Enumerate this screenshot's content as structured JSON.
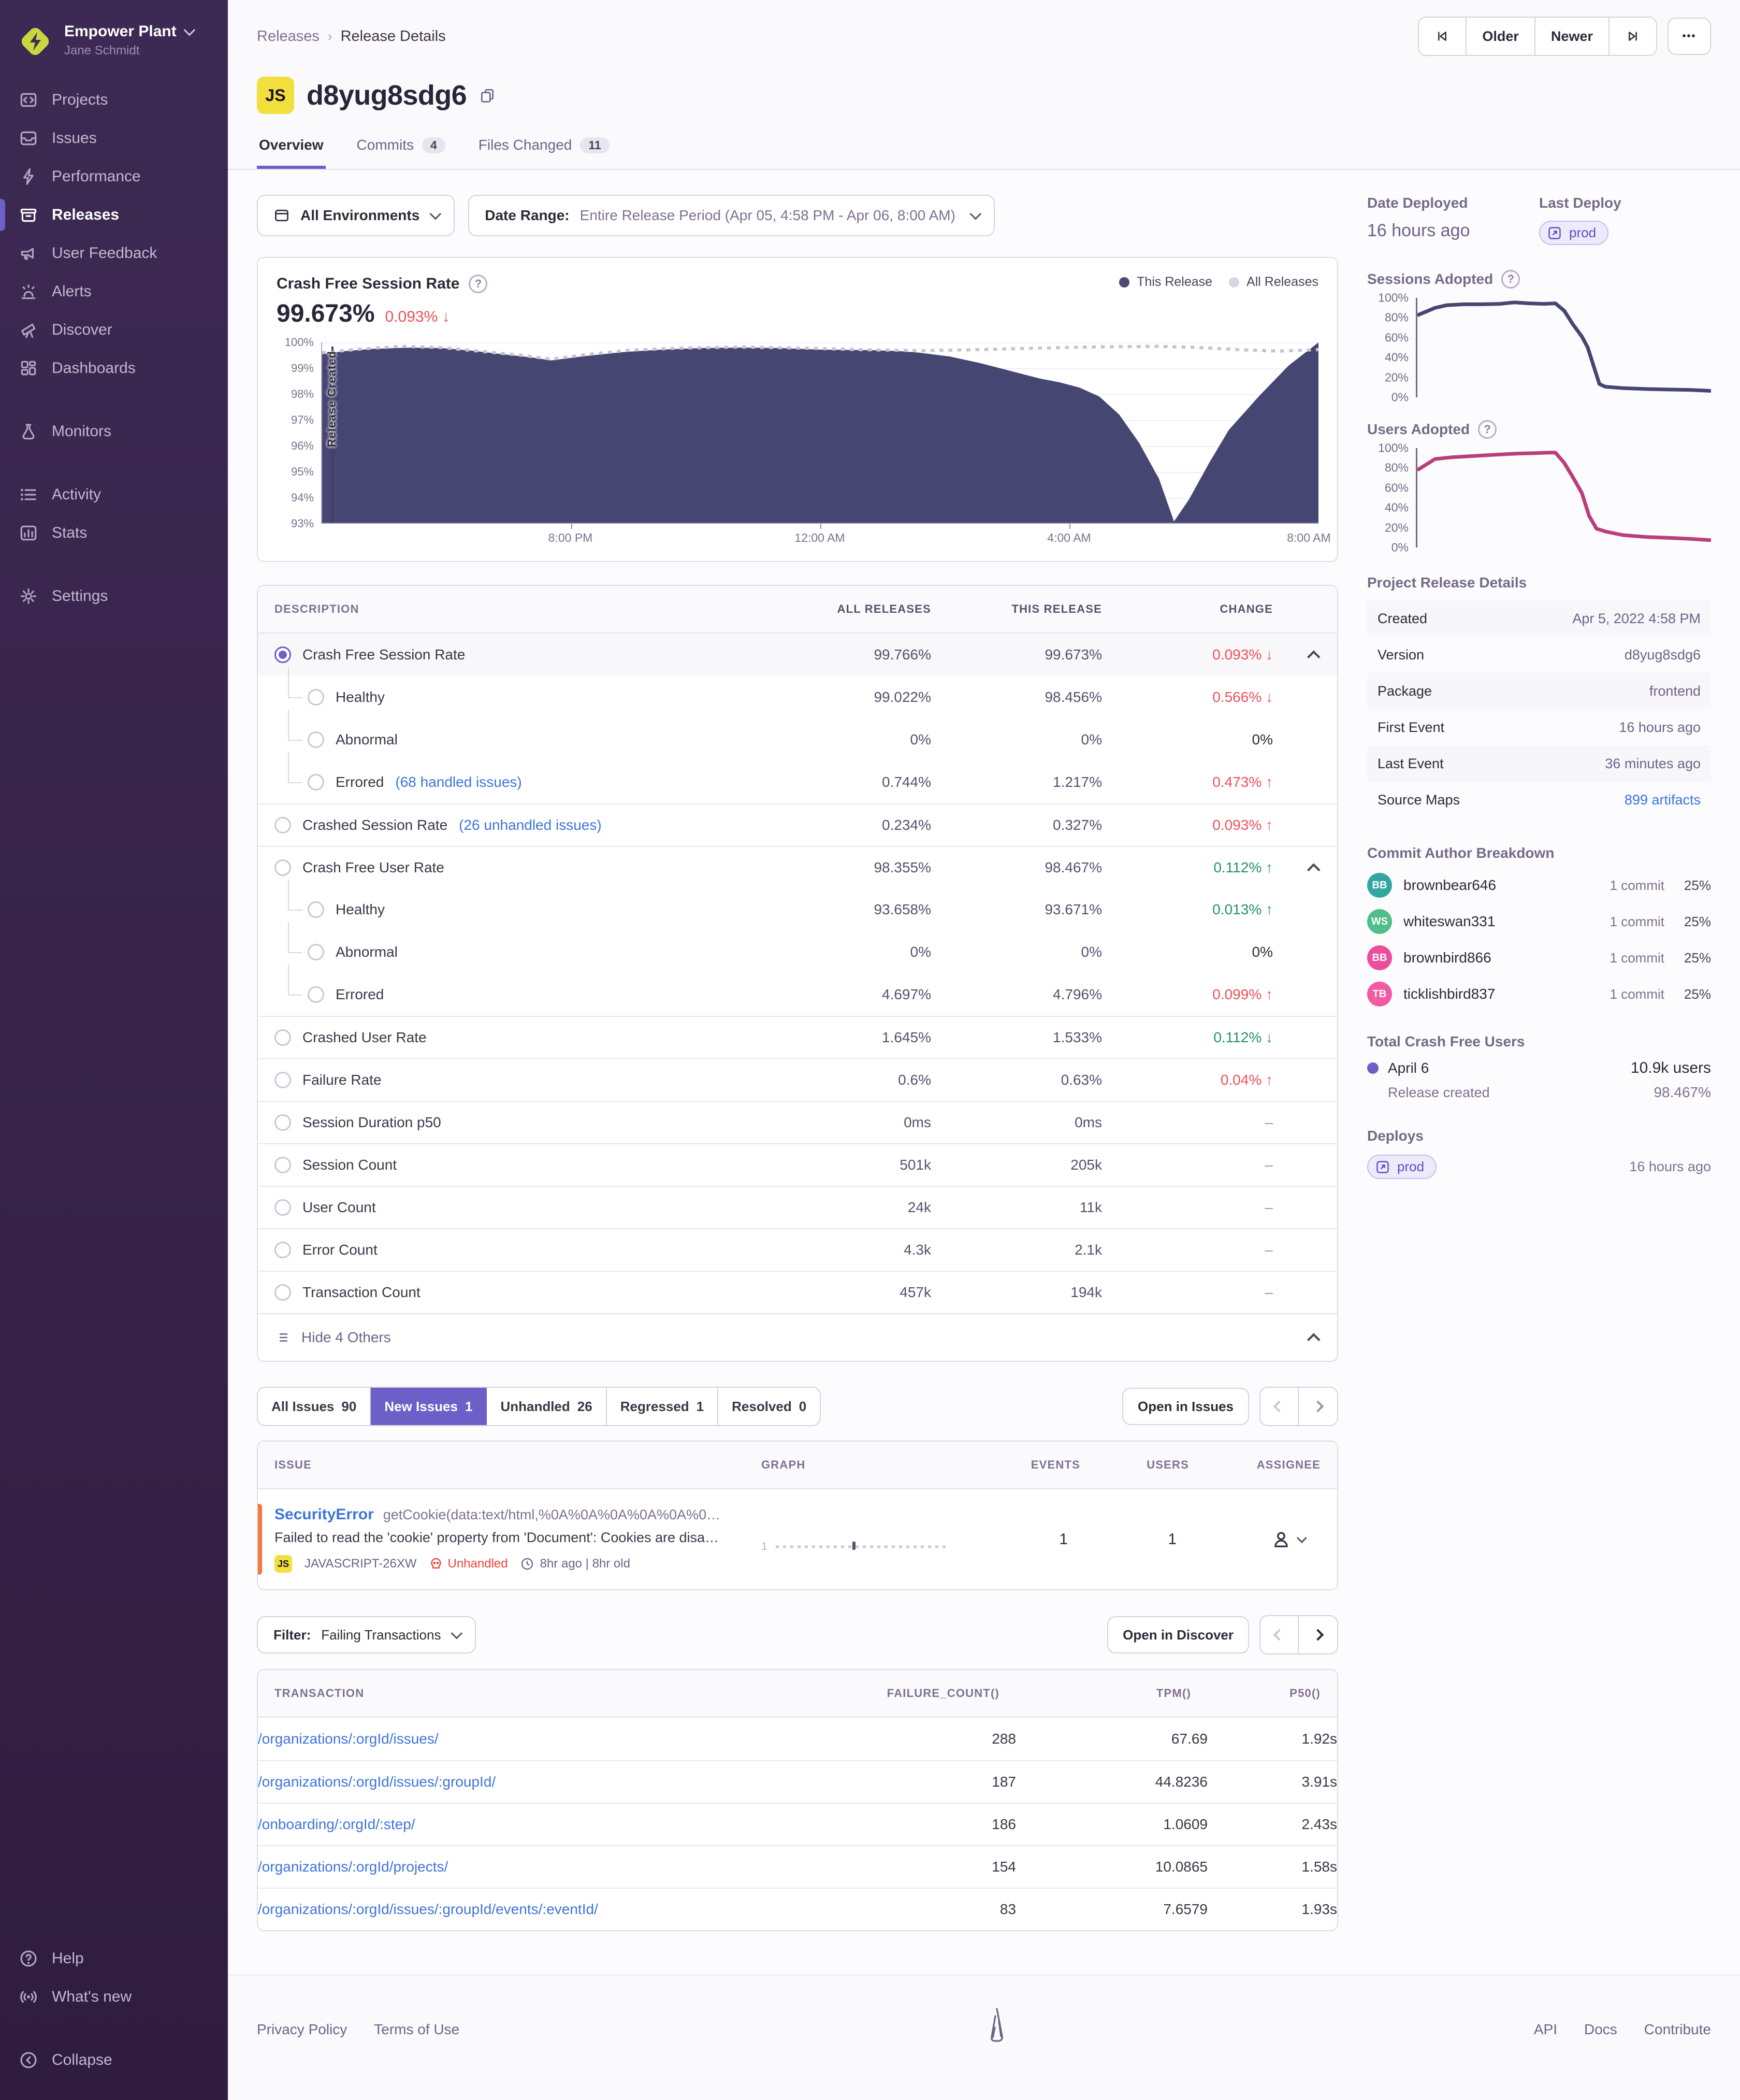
{
  "sidebar": {
    "org": "Empower Plant",
    "user": "Jane Schmidt",
    "items": [
      {
        "label": "Projects",
        "icon": "projects-icon"
      },
      {
        "label": "Issues",
        "icon": "issues-icon"
      },
      {
        "label": "Performance",
        "icon": "performance-icon"
      },
      {
        "label": "Releases",
        "icon": "releases-icon",
        "active": true
      },
      {
        "label": "User Feedback",
        "icon": "user-feedback-icon"
      },
      {
        "label": "Alerts",
        "icon": "alerts-icon"
      },
      {
        "label": "Discover",
        "icon": "discover-icon"
      },
      {
        "label": "Dashboards",
        "icon": "dashboards-icon"
      },
      {
        "label": "Monitors",
        "icon": "monitors-icon",
        "gap_before": true
      },
      {
        "label": "Activity",
        "icon": "activity-icon",
        "gap_before": true
      },
      {
        "label": "Stats",
        "icon": "stats-icon"
      },
      {
        "label": "Settings",
        "icon": "settings-icon",
        "gap_before": true
      }
    ],
    "footer_items": [
      {
        "label": "Help",
        "icon": "help-icon"
      },
      {
        "label": "What's new",
        "icon": "broadcast-icon"
      },
      {
        "label": "Collapse",
        "icon": "collapse-icon",
        "gap_before": true
      }
    ]
  },
  "header": {
    "breadcrumb": [
      "Releases",
      "Release Details"
    ],
    "platform_badge": "JS",
    "title": "d8yug8sdg6",
    "tabs": [
      {
        "label": "Overview",
        "active": true
      },
      {
        "label": "Commits",
        "count": "4"
      },
      {
        "label": "Files Changed",
        "count": "11"
      }
    ]
  },
  "toolbar": {
    "older_label": "Older",
    "newer_label": "Newer",
    "more_label": "•••"
  },
  "filters": {
    "environments_label": "All Environments",
    "date_range_label": "Date Range:",
    "date_range_value": "Entire Release Period (Apr 05, 4:58 PM - Apr 06, 8:00 AM)"
  },
  "charts": {
    "crash_free": {
      "title": "Crash Free Session Rate",
      "value": "99.673%",
      "change": "0.093%",
      "change_dir": "down",
      "legend": [
        {
          "label": "This Release",
          "color": "#4c4a72"
        },
        {
          "label": "All Releases",
          "color": "#d8d4e4"
        }
      ],
      "annotation": "Release Created",
      "y_ticks": [
        "100%",
        "99%",
        "98%",
        "97%",
        "96%",
        "95%",
        "94%",
        "93%"
      ],
      "x_ticks": [
        "8:00 PM",
        "12:00 AM",
        "4:00 AM",
        "8:00 AM"
      ],
      "y_min": 93,
      "y_max": 100,
      "fill_color": "#454672",
      "all_color": "#c7c1d2",
      "this_release": [
        [
          0,
          99.55
        ],
        [
          0.02,
          99.65
        ],
        [
          0.05,
          99.75
        ],
        [
          0.09,
          99.8
        ],
        [
          0.12,
          99.78
        ],
        [
          0.15,
          99.68
        ],
        [
          0.18,
          99.55
        ],
        [
          0.21,
          99.42
        ],
        [
          0.23,
          99.3
        ],
        [
          0.26,
          99.45
        ],
        [
          0.3,
          99.62
        ],
        [
          0.34,
          99.72
        ],
        [
          0.38,
          99.78
        ],
        [
          0.42,
          99.8
        ],
        [
          0.46,
          99.78
        ],
        [
          0.5,
          99.72
        ],
        [
          0.55,
          99.7
        ],
        [
          0.58,
          99.66
        ],
        [
          0.6,
          99.6
        ],
        [
          0.63,
          99.45
        ],
        [
          0.66,
          99.2
        ],
        [
          0.69,
          98.9
        ],
        [
          0.72,
          98.6
        ],
        [
          0.74,
          98.45
        ],
        [
          0.76,
          98.25
        ],
        [
          0.78,
          97.9
        ],
        [
          0.8,
          97.2
        ],
        [
          0.82,
          96.1
        ],
        [
          0.84,
          94.7
        ],
        [
          0.855,
          93.05
        ],
        [
          0.87,
          93.9
        ],
        [
          0.89,
          95.3
        ],
        [
          0.91,
          96.6
        ],
        [
          0.94,
          97.9
        ],
        [
          0.97,
          99.1
        ],
        [
          1,
          100
        ]
      ],
      "all_releases": [
        [
          0,
          99.6
        ],
        [
          0.04,
          99.75
        ],
        [
          0.08,
          99.85
        ],
        [
          0.12,
          99.8
        ],
        [
          0.16,
          99.65
        ],
        [
          0.2,
          99.5
        ],
        [
          0.23,
          99.35
        ],
        [
          0.27,
          99.55
        ],
        [
          0.31,
          99.7
        ],
        [
          0.36,
          99.78
        ],
        [
          0.42,
          99.82
        ],
        [
          0.48,
          99.78
        ],
        [
          0.54,
          99.72
        ],
        [
          0.6,
          99.68
        ],
        [
          0.66,
          99.72
        ],
        [
          0.72,
          99.78
        ],
        [
          0.78,
          99.83
        ],
        [
          0.84,
          99.85
        ],
        [
          0.88,
          99.8
        ],
        [
          0.92,
          99.72
        ],
        [
          0.96,
          99.66
        ],
        [
          1,
          99.72
        ]
      ]
    },
    "sessions_adopted": {
      "title": "Sessions Adopted",
      "y_ticks": [
        "100%",
        "80%",
        "60%",
        "40%",
        "20%",
        "0%"
      ],
      "color": "#454672",
      "points": [
        [
          0,
          85
        ],
        [
          0.06,
          93
        ],
        [
          0.1,
          96
        ],
        [
          0.16,
          97
        ],
        [
          0.22,
          97
        ],
        [
          0.28,
          97.5
        ],
        [
          0.33,
          99
        ],
        [
          0.38,
          98
        ],
        [
          0.43,
          97.5
        ],
        [
          0.47,
          98
        ],
        [
          0.5,
          90
        ],
        [
          0.53,
          75
        ],
        [
          0.56,
          62
        ],
        [
          0.58,
          50
        ],
        [
          0.6,
          30
        ],
        [
          0.62,
          10
        ],
        [
          0.64,
          7
        ],
        [
          0.7,
          5.5
        ],
        [
          0.78,
          4.5
        ],
        [
          0.86,
          4
        ],
        [
          0.93,
          3.5
        ],
        [
          1,
          2.5
        ]
      ]
    },
    "users_adopted": {
      "title": "Users Adopted",
      "y_ticks": [
        "100%",
        "80%",
        "60%",
        "40%",
        "20%",
        "0%"
      ],
      "color": "#b93e7b",
      "points": [
        [
          0,
          80
        ],
        [
          0.06,
          92
        ],
        [
          0.12,
          94
        ],
        [
          0.2,
          95.5
        ],
        [
          0.28,
          97
        ],
        [
          0.34,
          98
        ],
        [
          0.4,
          98.5
        ],
        [
          0.45,
          99
        ],
        [
          0.47,
          99
        ],
        [
          0.5,
          88
        ],
        [
          0.53,
          72
        ],
        [
          0.56,
          55
        ],
        [
          0.585,
          30
        ],
        [
          0.61,
          16
        ],
        [
          0.64,
          13
        ],
        [
          0.7,
          9
        ],
        [
          0.78,
          7
        ],
        [
          0.86,
          6
        ],
        [
          0.93,
          5
        ],
        [
          1,
          3.5
        ]
      ]
    }
  },
  "metrics": {
    "columns": [
      "Description",
      "All Releases",
      "This Release",
      "Change"
    ],
    "rows": [
      {
        "name": "Crash Free Session Rate",
        "all": "99.766%",
        "this": "99.673%",
        "change": "0.093%",
        "dir": "down",
        "tone": "red",
        "indent": 0,
        "selected": true,
        "chevron": true
      },
      {
        "name": "Healthy",
        "all": "99.022%",
        "this": "98.456%",
        "change": "0.566%",
        "dir": "down",
        "tone": "red",
        "indent": 1
      },
      {
        "name": "Abnormal",
        "all": "0%",
        "this": "0%",
        "change": "0%",
        "tone": "plain",
        "indent": 1
      },
      {
        "name": "Errored",
        "link": "(68 handled issues)",
        "all": "0.744%",
        "this": "1.217%",
        "change": "0.473%",
        "dir": "up",
        "tone": "red",
        "indent": 1,
        "sub_last": true
      },
      {
        "name": "Crashed Session Rate",
        "link": "(26 unhandled issues)",
        "all": "0.234%",
        "this": "0.327%",
        "change": "0.093%",
        "dir": "up",
        "tone": "red",
        "indent": 0
      },
      {
        "name": "Crash Free User Rate",
        "all": "98.355%",
        "this": "98.467%",
        "change": "0.112%",
        "dir": "up",
        "tone": "green",
        "indent": 0,
        "chevron": true
      },
      {
        "name": "Healthy",
        "all": "93.658%",
        "this": "93.671%",
        "change": "0.013%",
        "dir": "up",
        "tone": "green",
        "indent": 1
      },
      {
        "name": "Abnormal",
        "all": "0%",
        "this": "0%",
        "change": "0%",
        "tone": "plain",
        "indent": 1
      },
      {
        "name": "Errored",
        "all": "4.697%",
        "this": "4.796%",
        "change": "0.099%",
        "dir": "up",
        "tone": "red",
        "indent": 1,
        "sub_last": true
      },
      {
        "name": "Crashed User Rate",
        "all": "1.645%",
        "this": "1.533%",
        "change": "0.112%",
        "dir": "down",
        "tone": "green",
        "indent": 0
      },
      {
        "name": "Failure Rate",
        "all": "0.6%",
        "this": "0.63%",
        "change": "0.04%",
        "dir": "up",
        "tone": "red",
        "indent": 0
      },
      {
        "name": "Session Duration p50",
        "all": "0ms",
        "this": "0ms",
        "change": "–",
        "tone": "muted",
        "indent": 0
      },
      {
        "name": "Session Count",
        "all": "501k",
        "this": "205k",
        "change": "–",
        "tone": "muted",
        "indent": 0
      },
      {
        "name": "User Count",
        "all": "24k",
        "this": "11k",
        "change": "–",
        "tone": "muted",
        "indent": 0
      },
      {
        "name": "Error Count",
        "all": "4.3k",
        "this": "2.1k",
        "change": "–",
        "tone": "muted",
        "indent": 0
      },
      {
        "name": "Transaction Count",
        "all": "457k",
        "this": "194k",
        "change": "–",
        "tone": "muted",
        "indent": 0
      }
    ],
    "hide_label": "Hide 4 Others"
  },
  "issues": {
    "tabs": [
      {
        "label": "All Issues",
        "count": "90"
      },
      {
        "label": "New Issues",
        "count": "1",
        "active": true
      },
      {
        "label": "Unhandled",
        "count": "26"
      },
      {
        "label": "Regressed",
        "count": "1"
      },
      {
        "label": "Resolved",
        "count": "0"
      }
    ],
    "open_label": "Open in Issues",
    "columns": [
      "Issue",
      "Graph",
      "Events",
      "Users",
      "Assignee"
    ],
    "row": {
      "title": "SecurityError",
      "culprit": "getCookie(data:text/html,%0A%0A%0A%0A%0A%0…",
      "message": "Failed to read the 'cookie' property from 'Document': Cookies are disa…",
      "platform": "JS",
      "short_id": "JAVASCRIPT-26XW",
      "unhandled_label": "Unhandled",
      "age": "8hr ago | 8hr old",
      "graph_label": "1",
      "events": "1",
      "users": "1"
    }
  },
  "transactions": {
    "filter_label": "Filter:",
    "filter_value": "Failing Transactions",
    "open_label": "Open in Discover",
    "columns": [
      "Transaction",
      "failure_count()",
      "tpm()",
      "p50()"
    ],
    "rows": [
      {
        "path": "/organizations/:orgId/issues/",
        "failures": "288",
        "tpm": "67.69",
        "p50": "1.92s"
      },
      {
        "path": "/organizations/:orgId/issues/:groupId/",
        "failures": "187",
        "tpm": "44.8236",
        "p50": "3.91s"
      },
      {
        "path": "/onboarding/:orgId/:step/",
        "failures": "186",
        "tpm": "1.0609",
        "p50": "2.43s"
      },
      {
        "path": "/organizations/:orgId/projects/",
        "failures": "154",
        "tpm": "10.0865",
        "p50": "1.58s"
      },
      {
        "path": "/organizations/:orgId/issues/:groupId/events/:eventId/",
        "failures": "83",
        "tpm": "7.6579",
        "p50": "1.93s"
      }
    ]
  },
  "aside": {
    "date_deployed_label": "Date Deployed",
    "date_deployed_value": "16 hours ago",
    "last_deploy_label": "Last Deploy",
    "last_deploy_env": "prod",
    "details": {
      "title": "Project Release Details",
      "rows": [
        {
          "label": "Created",
          "value": "Apr 5, 2022 4:58 PM",
          "alt": true
        },
        {
          "label": "Version",
          "value": "d8yug8sdg6"
        },
        {
          "label": "Package",
          "value": "frontend",
          "alt": true
        },
        {
          "label": "First Event",
          "value": "16 hours ago"
        },
        {
          "label": "Last Event",
          "value": "36 minutes ago",
          "alt": true
        },
        {
          "label": "Source Maps",
          "value": "899 artifacts",
          "link": true
        }
      ]
    },
    "authors": {
      "title": "Commit Author Breakdown",
      "rows": [
        {
          "initials": "BB",
          "name": "brownbear646",
          "commits": "1 commit",
          "pct": "25%",
          "color": "#33a6a2"
        },
        {
          "initials": "WS",
          "name": "whiteswan331",
          "commits": "1 commit",
          "pct": "25%",
          "color": "#4fbe89"
        },
        {
          "initials": "BB",
          "name": "brownbird866",
          "commits": "1 commit",
          "pct": "25%",
          "color": "#ec4d9c"
        },
        {
          "initials": "TB",
          "name": "ticklishbird837",
          "commits": "1 commit",
          "pct": "25%",
          "color": "#f25aa2"
        }
      ]
    },
    "total_crash_free": {
      "title": "Total Crash Free Users",
      "date": "April 6",
      "users": "10.9k users",
      "sub_label": "Release created",
      "sub_value": "98.467%"
    },
    "deploys": {
      "title": "Deploys",
      "env": "prod",
      "time": "16 hours ago"
    }
  },
  "footer": {
    "left": [
      "Privacy Policy",
      "Terms of Use"
    ],
    "right": [
      "API",
      "Docs",
      "Contribute"
    ]
  }
}
